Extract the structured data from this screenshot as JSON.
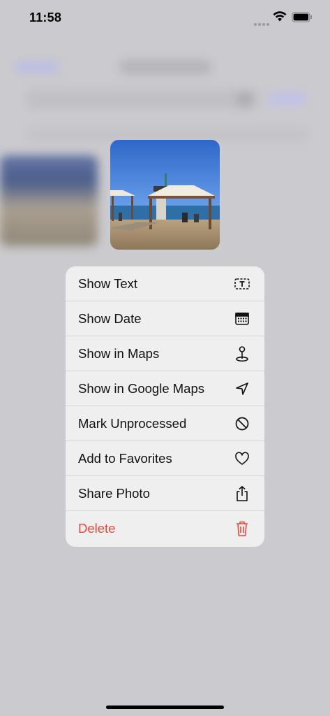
{
  "status_bar": {
    "time": "11:58"
  },
  "context_menu": {
    "items": [
      {
        "label": "Show Text",
        "icon": "text-box-icon"
      },
      {
        "label": "Show Date",
        "icon": "calendar-icon"
      },
      {
        "label": "Show in Maps",
        "icon": "map-pin-icon"
      },
      {
        "label": "Show in Google Maps",
        "icon": "location-arrow-icon"
      },
      {
        "label": "Mark Unprocessed",
        "icon": "prohibited-icon"
      },
      {
        "label": "Add to Favorites",
        "icon": "heart-icon"
      },
      {
        "label": "Share Photo",
        "icon": "share-icon"
      },
      {
        "label": "Delete",
        "icon": "trash-icon",
        "destructive": true
      }
    ]
  },
  "colors": {
    "destructive": "#f0453a",
    "menu_bg": "#efeff0",
    "dim_bg": "#cbcace"
  }
}
